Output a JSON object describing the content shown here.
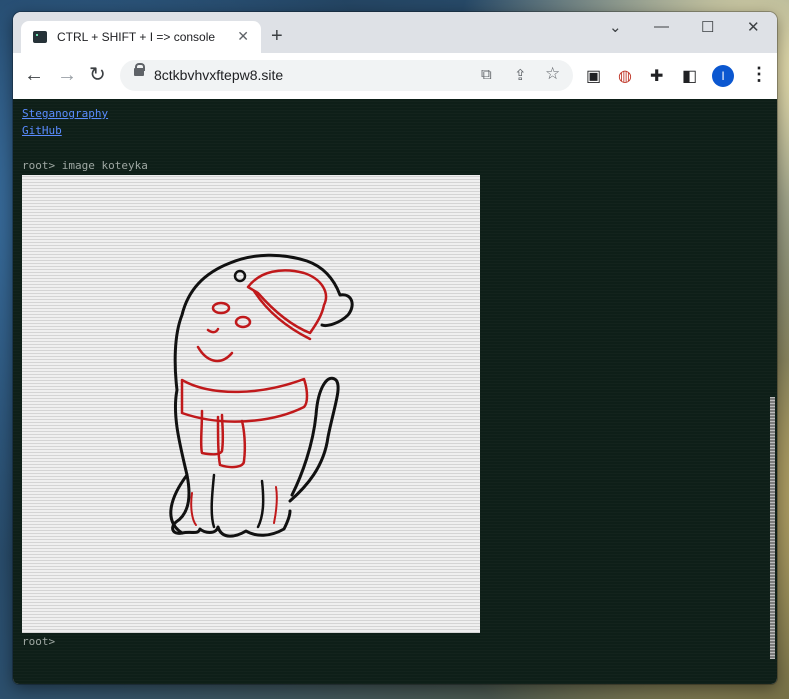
{
  "browser": {
    "tab": {
      "title": "CTRL + SHIFT + I => console",
      "close_glyph": "✕",
      "favicon": "terminal-icon"
    },
    "new_tab_glyph": "+",
    "window_controls": {
      "collapse": "⌄",
      "minimize": "—",
      "maximize": "☐",
      "close": "✕"
    },
    "nav": {
      "back": "←",
      "forward": "→",
      "reload": "↻"
    },
    "address": {
      "url": "8ctkbvhvxftepw8.site"
    },
    "omnibox_icons": {
      "translate": "⧉",
      "share": "⇪",
      "bookmark": "☆"
    },
    "extensions": {
      "ext1": "▣",
      "ext2": "◍",
      "puzzle": "✚",
      "sidepanel": "◧"
    },
    "profile_initial": "I",
    "menu_glyph": "⋮"
  },
  "terminal": {
    "links": [
      "Steganography",
      "GitHub"
    ],
    "command_line": "root> image koteyka",
    "prompt": "root>",
    "image_name": "koteyka"
  },
  "colors": {
    "terminal_bg": "#0e1f18",
    "link": "#5a8cff",
    "prompt_text": "#9ea7a2",
    "drawing_outline": "#111111",
    "drawing_accent": "#c0191b",
    "profile": "#0b57d0"
  }
}
